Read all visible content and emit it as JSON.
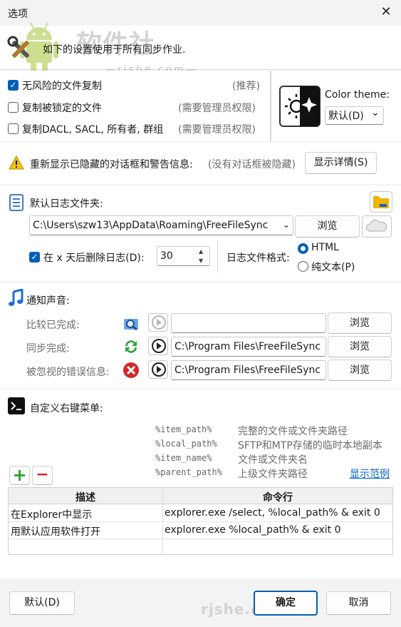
{
  "window": {
    "title": "选项",
    "close_glyph": "✕"
  },
  "header": {
    "description": "如下的设置使用于所有同步作业.",
    "watermark": "软件社",
    "watermark_url": "—rjshe.com—"
  },
  "options": {
    "items": [
      {
        "label": "无风险的文件复制",
        "hint": "(推荐)",
        "checked": true
      },
      {
        "label": "复制被锁定的文件",
        "hint": "(需要管理员权限)",
        "checked": false
      },
      {
        "label": "复制DACL, SACL, 所有者, 群组",
        "hint": "(需要管理员权限)",
        "checked": false
      }
    ],
    "check_glyph": "✓"
  },
  "theme": {
    "label": "Color theme:",
    "value": "默认(D)",
    "chevron": "⌄"
  },
  "warnings": {
    "label": "重新显示已隐藏的对话框和警告信息:",
    "hint": "(没有对话框被隐藏)",
    "button": "显示详情(S)"
  },
  "log": {
    "label": "默认日志文件夹:",
    "path": "C:\\Users\\szw13\\AppData\\Roaming\\FreeFileSync",
    "browse": "浏览",
    "delete_label": "在 x 天后删除日志(D):",
    "days": "30",
    "format_label": "日志文件格式:",
    "formats": [
      {
        "label": "HTML",
        "selected": true
      },
      {
        "label": "纯文本(P)",
        "selected": false
      }
    ]
  },
  "sounds": {
    "label": "通知声音:",
    "rows": [
      {
        "label": "比较已完成:",
        "path": "",
        "browse": "浏览",
        "icon": "magnifier-icon",
        "enabled": false
      },
      {
        "label": "同步完成:",
        "path": "C:\\Program Files\\FreeFileSync",
        "browse": "浏览",
        "icon": "sync-icon",
        "enabled": true
      },
      {
        "label": "被忽视的错误信息:",
        "path": "C:\\Program Files\\FreeFileSync",
        "browse": "浏览",
        "icon": "error-icon",
        "enabled": true
      }
    ]
  },
  "context_menu": {
    "label": "自定义右键菜单:",
    "macros": [
      {
        "macro": "%item_path%",
        "desc": "完整的文件或文件夹路径"
      },
      {
        "macro": "%local_path%",
        "desc": "SFTP和MTP存储的临时本地副本"
      },
      {
        "macro": "%item_name%",
        "desc": "文件或文件夹名"
      },
      {
        "macro": "%parent_path%",
        "desc": "上级文件夹路径"
      }
    ],
    "examples_link": "显示范例",
    "columns": [
      "描述",
      "命令行"
    ],
    "rows": [
      {
        "desc": "在Explorer中显示",
        "cmd": "explorer.exe /select, %local_path% & exit 0"
      },
      {
        "desc": "用默认应用软件打开",
        "cmd": "explorer.exe %local_path% & exit 0"
      }
    ],
    "add_glyph": "+",
    "remove_glyph": "−"
  },
  "footer": {
    "default": "默认(D)",
    "ok": "确定",
    "cancel": "取消",
    "watermark": "rjshe.com"
  }
}
